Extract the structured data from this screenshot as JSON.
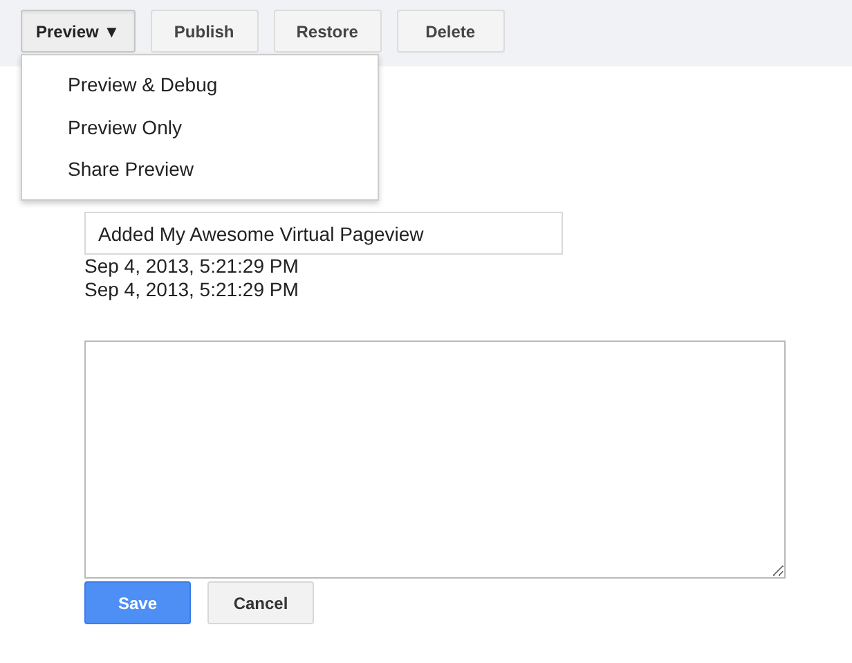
{
  "toolbar": {
    "buttons": [
      {
        "label": "Preview",
        "caret": "▼",
        "expanded": true,
        "kind": "dropdown"
      },
      {
        "label": "Publish",
        "kind": "plain"
      },
      {
        "label": "Restore",
        "kind": "plain"
      },
      {
        "label": "Delete",
        "kind": "plain"
      }
    ]
  },
  "dropdown_menu": {
    "items": [
      "Preview & Debug",
      "Preview Only",
      "Share Preview"
    ]
  },
  "form": {
    "name_value": "Added My Awesome Virtual Pageview",
    "timestamps": [
      "Sep 4, 2013, 5:21:29 PM",
      "Sep 4, 2013, 5:21:29 PM"
    ],
    "buttons": [
      {
        "label": "Save",
        "kind": "primary"
      },
      {
        "label": "Cancel",
        "kind": "secondary"
      }
    ]
  }
}
